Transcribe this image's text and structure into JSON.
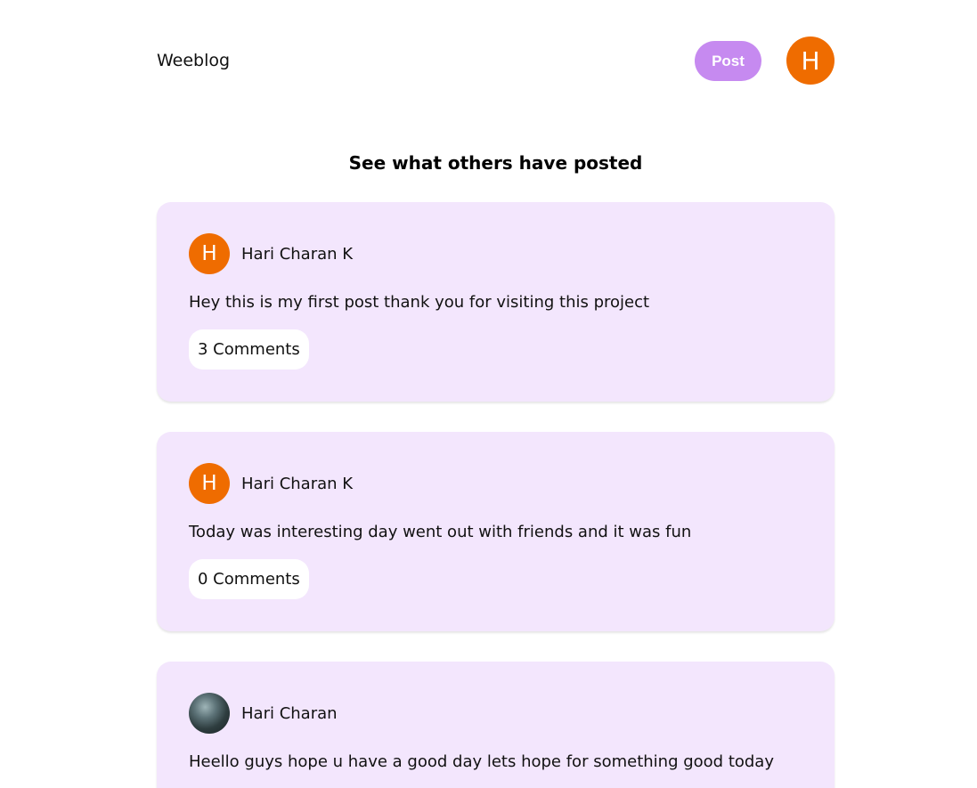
{
  "header": {
    "brand": "Weeblog",
    "post_button": "Post",
    "user_initial": "H"
  },
  "feed": {
    "title": "See what others have posted",
    "posts": [
      {
        "author_initial": "H",
        "author": "Hari Charan K",
        "text": "Hey this is my first post thank you for visiting this project",
        "comments": "3 Comments"
      },
      {
        "author_initial": "H",
        "author": "Hari Charan K",
        "text": "Today was interesting day went out with friends and it was fun",
        "comments": "0 Comments"
      },
      {
        "author_initial": "",
        "author": "Hari Charan",
        "text": "Heello guys hope u have a good day lets hope for something good today",
        "comments": ""
      }
    ]
  },
  "colors": {
    "accent": "#c68af0",
    "avatar": "#ef6c00",
    "card_bg": "#f3e6fd"
  }
}
